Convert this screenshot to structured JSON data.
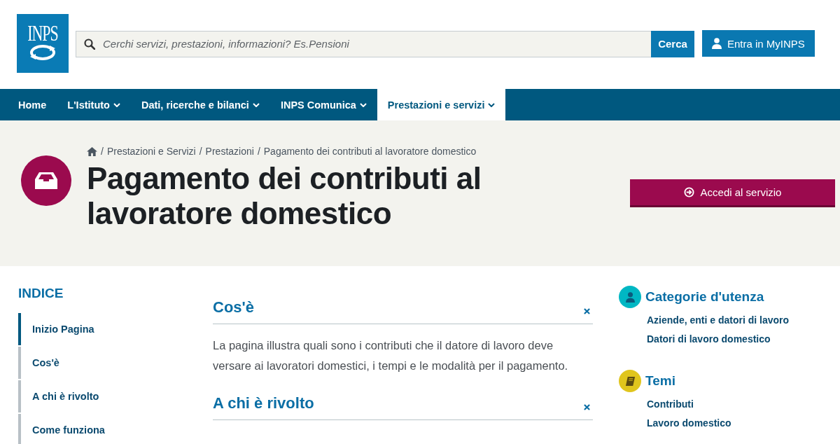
{
  "header": {
    "logo_text": "INPS",
    "search": {
      "placeholder": "Cerchi servizi, prestazioni, informazioni? Es.Pensioni",
      "button": "Cerca"
    },
    "login_button": "Entra in MyINPS"
  },
  "nav": [
    {
      "label": "Home",
      "has_menu": false,
      "selected": false
    },
    {
      "label": "L'Istituto",
      "has_menu": true,
      "selected": false
    },
    {
      "label": "Dati, ricerche e bilanci",
      "has_menu": true,
      "selected": false
    },
    {
      "label": "INPS Comunica",
      "has_menu": true,
      "selected": false
    },
    {
      "label": "Prestazioni e servizi",
      "has_menu": true,
      "selected": true
    }
  ],
  "hero": {
    "breadcrumb": [
      {
        "separator": "/",
        "label": "Prestazioni e Servizi"
      },
      {
        "separator": "/",
        "label": "Prestazioni"
      },
      {
        "separator": "/",
        "label": "Pagamento dei contributi al lavoratore domestico"
      }
    ],
    "title": "Pagamento dei contributi al lavoratore domestico",
    "action_button": "Accedi al servizio"
  },
  "index": {
    "title": "INDICE",
    "items": [
      {
        "label": "Inizio Pagina",
        "selected": true
      },
      {
        "label": "Cos'è",
        "selected": false
      },
      {
        "label": "A chi è rivolto",
        "selected": false
      },
      {
        "label": "Come funziona",
        "selected": false
      }
    ]
  },
  "sections": [
    {
      "title": "Cos'è",
      "text": "La pagina illustra quali sono i contributi che il datore di lavoro deve versare ai lavoratori domestici, i tempi e le modalità per il pagamento."
    },
    {
      "title": "A chi è rivolto"
    }
  ],
  "aside": [
    {
      "title": "Categorie d'utenza",
      "kind": "person",
      "color": "#00b7c3",
      "links": [
        "Aziende, enti e datori di lavoro",
        "Datori di lavoro domestico"
      ]
    },
    {
      "title": "Temi",
      "kind": "book",
      "color": "#e0c51d",
      "links": [
        "Contributi",
        "Lavoro domestico"
      ]
    }
  ]
}
